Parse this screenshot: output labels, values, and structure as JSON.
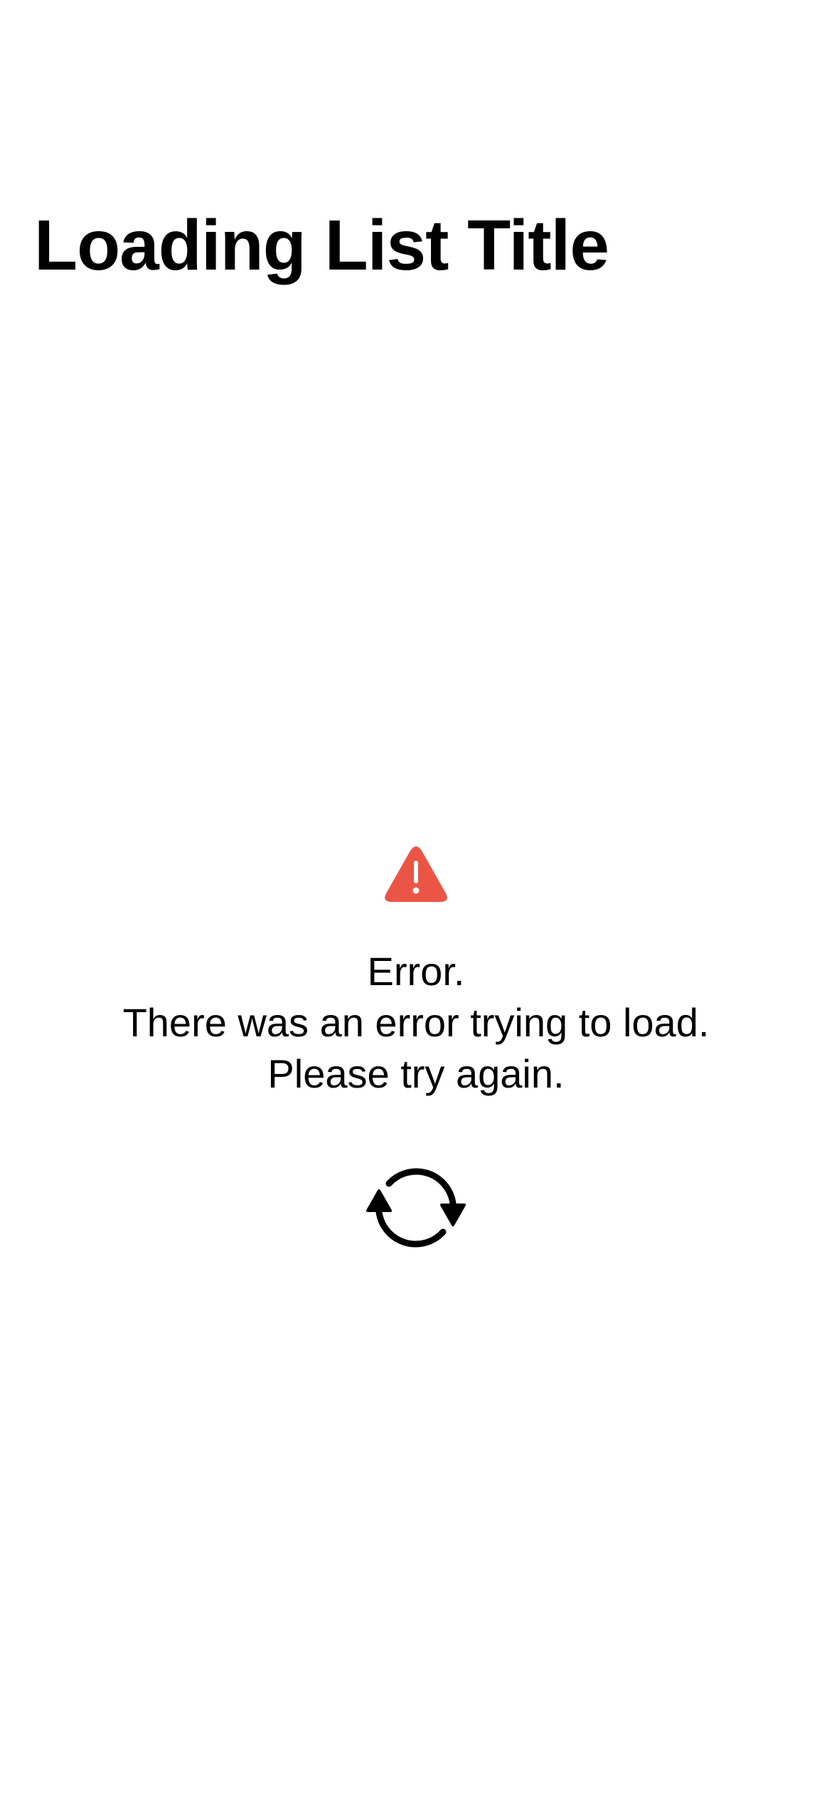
{
  "header": {
    "title": "Loading List Title"
  },
  "error": {
    "icon": "exclamationmark-triangle-fill-icon",
    "icon_color": "#EB5545",
    "lines": [
      "Error.",
      "There was an error trying to load.",
      "Please try again."
    ]
  },
  "retry": {
    "icon": "arrow-triangle-2-circlepath-icon",
    "icon_color": "#000000"
  }
}
